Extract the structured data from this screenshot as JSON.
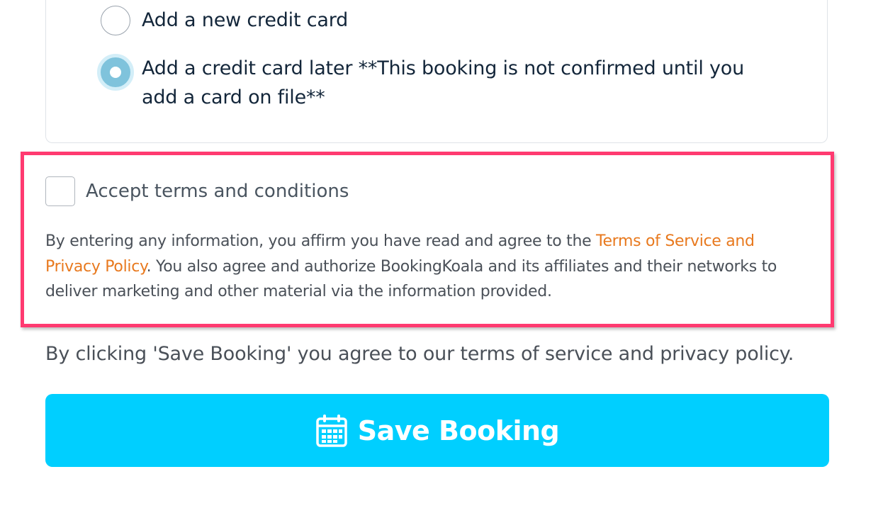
{
  "payment_options": {
    "new_card_label": "Add a new credit card",
    "later_label": "Add a credit card later **This booking is not confirmed until you add a card on file**",
    "selected": "later"
  },
  "terms": {
    "checkbox_label": "Accept terms and conditions",
    "checked": false,
    "text_before_link": "By entering any information, you affirm you have read and agree to the ",
    "link_text": "Terms of Service and Privacy Policy",
    "text_after_link": ". You also agree and authorize BookingKoala and its affiliates and their networks to deliver marketing and other material via the information provided."
  },
  "agree_note": "By clicking 'Save Booking' you agree to our terms of service and privacy policy.",
  "save_button": {
    "label": "Save Booking",
    "icon": "calendar-icon"
  },
  "colors": {
    "highlight_border": "#ff3a70",
    "link": "#e8791e",
    "button": "#00cfff",
    "radio_selected": "#7fc3dc"
  }
}
